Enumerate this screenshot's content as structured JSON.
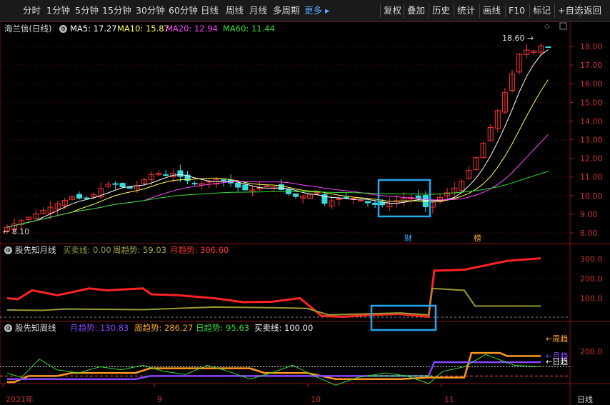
{
  "toolbar": {
    "periods": [
      "分时",
      "1分钟",
      "5分钟",
      "15分钟",
      "30分钟",
      "60分钟",
      "日线",
      "周线",
      "月线",
      "多周期"
    ],
    "more": "更多",
    "actions": [
      "复权",
      "叠加",
      "历史",
      "统计",
      "画线",
      "F10",
      "标记",
      "+自选",
      "返回"
    ]
  },
  "main_chart": {
    "title": "海兰信(日线)",
    "ma": [
      {
        "label": "MA5: 17.27",
        "color": "#ffffff"
      },
      {
        "label": "MA10: 15.87",
        "color": "#ffff55"
      },
      {
        "label": "MA20: 12.94",
        "color": "#ff44ff"
      },
      {
        "label": "MA60: 11.44",
        "color": "#33dd33"
      }
    ],
    "high_label": "18.60",
    "low_label": "8.10",
    "markers": [
      {
        "text": "财",
        "color": "#44aaff"
      },
      {
        "text": "榜",
        "color": "#ffaa44"
      }
    ],
    "y_ticks": [
      "18.00",
      "17.00",
      "16.00",
      "15.00",
      "14.00",
      "13.00",
      "12.00",
      "11.00",
      "10.00",
      "9.00",
      "8.00"
    ]
  },
  "panel2": {
    "title": "股先知月线",
    "series": [
      {
        "label": "买卖线: 0.00",
        "color": "#999944"
      },
      {
        "label": "周趋势: 59.03",
        "color": "#aaaa44"
      },
      {
        "label": "月趋势: 306.60",
        "color": "#ff3333"
      }
    ],
    "y_ticks": [
      "300.0",
      "200.0",
      "100.0"
    ]
  },
  "panel3": {
    "title": "股先知周线",
    "series": [
      {
        "label": "月趋势: 130.83",
        "color": "#8844ff"
      },
      {
        "label": "周趋势: 286.27",
        "color": "#ffaa33"
      },
      {
        "label": "日趋势: 95.63",
        "color": "#33dd33"
      },
      {
        "label": "买卖线: 100.00",
        "color": "#ffffff"
      }
    ],
    "y_ticks": [
      "200.0"
    ],
    "right_labels": [
      {
        "text": "←周趋",
        "color": "#ffaa33"
      },
      {
        "text": "←月趋",
        "color": "#8844ff"
      },
      {
        "text": "←日趋",
        "color": "#ffffff"
      }
    ]
  },
  "x_axis": {
    "labels": [
      "2021年",
      "9",
      "10",
      "11"
    ]
  },
  "bottom_right": "日线",
  "chart_data": {
    "type": "candlestick",
    "y_range": [
      8.0,
      18.6
    ],
    "ma_values": {
      "MA5": 17.27,
      "MA10": 15.87,
      "MA20": 12.94,
      "MA60": 11.44
    },
    "high": 18.6,
    "low": 8.1,
    "month_labels": [
      "2021年",
      "9",
      "10",
      "11"
    ]
  }
}
